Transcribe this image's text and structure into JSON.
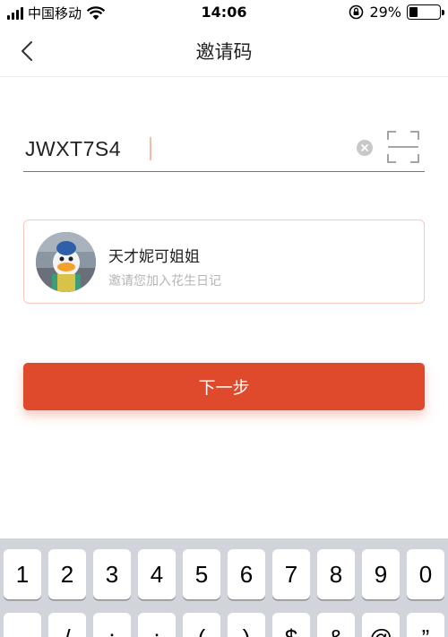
{
  "status_bar": {
    "carrier": "中国移动",
    "time": "14:06",
    "battery": "29%",
    "battery_level": 0.29,
    "signal_bars": 4,
    "icons": [
      "signal-icon",
      "wifi-icon",
      "rotation-lock-icon",
      "battery-icon"
    ]
  },
  "nav": {
    "title": "邀请码",
    "back_icon": "chevron-left-icon"
  },
  "code_input": {
    "value": "JWXT7S4",
    "clear_icon": "clear-icon",
    "scan_icon": "scan-icon"
  },
  "inviter": {
    "name": "天才妮可姐姐",
    "subtitle": "邀请您加入花生日记"
  },
  "next_button": {
    "label": "下一步"
  },
  "keyboard": {
    "row1": [
      "1",
      "2",
      "3",
      "4",
      "5",
      "6",
      "7",
      "8",
      "9",
      "0"
    ],
    "row2": [
      "-",
      "/",
      ":",
      ";",
      "(",
      ")",
      "$",
      "&",
      "@",
      "”"
    ]
  },
  "colors": {
    "accent": "#e04a2c",
    "card_border": "#f6c8bf",
    "keyboard_bg": "#d1d4da"
  }
}
